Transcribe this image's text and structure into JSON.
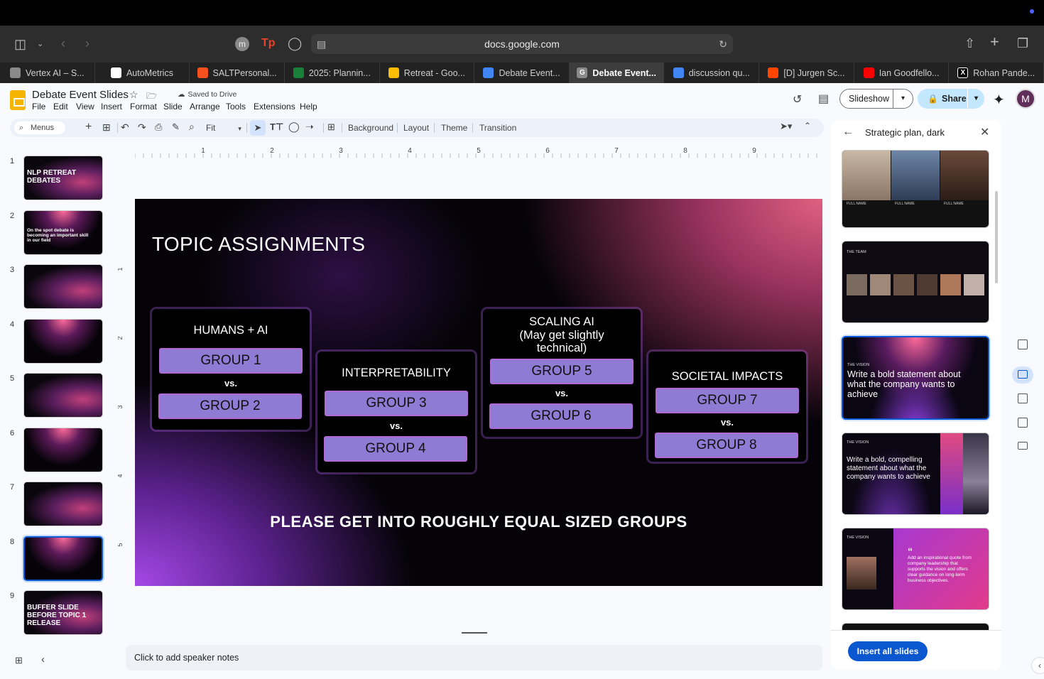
{
  "browser": {
    "url": "docs.google.com",
    "tabs": [
      {
        "label": "Vertex AI – S...",
        "icon": "google-cloud-icon",
        "color": "#8a8a8a"
      },
      {
        "label": "AutoMetrics",
        "icon": "automatrics-icon",
        "color": "#ffffff"
      },
      {
        "label": "SALTPersonal...",
        "icon": "flame-icon",
        "color": "#f4511e"
      },
      {
        "label": "2025: Plannin...",
        "icon": "sheets-icon",
        "color": "#188038"
      },
      {
        "label": "Retreat - Goo...",
        "icon": "drive-icon",
        "color": "#fbbc04"
      },
      {
        "label": "Debate Event...",
        "icon": "docs-icon",
        "color": "#4285f4"
      },
      {
        "label": "Debate Event...",
        "icon": "g-icon",
        "color": "#8a8a8a",
        "active": true
      },
      {
        "label": "discussion qu...",
        "icon": "docs-icon",
        "color": "#4285f4"
      },
      {
        "label": "[D] Jurgen Sc...",
        "icon": "reddit-icon",
        "color": "#ff4500"
      },
      {
        "label": "Ian Goodfello...",
        "icon": "youtube-icon",
        "color": "#ff0000"
      },
      {
        "label": "Rohan Pande...",
        "icon": "x-icon",
        "color": "#000000"
      }
    ]
  },
  "doc": {
    "title": "Debate Event Slides",
    "saved_status": "Saved to Drive",
    "menus": [
      "File",
      "Edit",
      "View",
      "Insert",
      "Format",
      "Slide",
      "Arrange",
      "Tools",
      "Extensions",
      "Help"
    ]
  },
  "toolbar": {
    "menus_label": "Menus",
    "zoom": "Fit",
    "background": "Background",
    "layout": "Layout",
    "theme": "Theme",
    "transition": "Transition"
  },
  "header_actions": {
    "slideshow": "Slideshow",
    "share": "Share",
    "avatar_letter": "M"
  },
  "filmstrip": [
    {
      "num": "1",
      "text": "NLP RETREAT DEBATES"
    },
    {
      "num": "2",
      "text": "On the spot debate is becoming an important skill in our field"
    },
    {
      "num": "3",
      "text": ""
    },
    {
      "num": "4",
      "text": ""
    },
    {
      "num": "5",
      "text": ""
    },
    {
      "num": "6",
      "text": ""
    },
    {
      "num": "7",
      "text": ""
    },
    {
      "num": "8",
      "text": "",
      "selected": true
    },
    {
      "num": "9",
      "text": "BUFFER SLIDE BEFORE TOPIC 1 RELEASE"
    }
  ],
  "ruler": {
    "h": [
      "1",
      "2",
      "3",
      "4",
      "5",
      "6",
      "7",
      "8",
      "9"
    ],
    "v": [
      "1",
      "2",
      "3",
      "4",
      "5"
    ]
  },
  "slide": {
    "title": "TOPIC ASSIGNMENTS",
    "topics": [
      {
        "heading": "HUMANS + AI",
        "group_a": "GROUP 1",
        "vs": "vs.",
        "group_b": "GROUP 2"
      },
      {
        "heading": "INTERPRETABILITY",
        "group_a": "GROUP 3",
        "vs": "vs.",
        "group_b": "GROUP 4"
      },
      {
        "heading": "SCALING AI\n(May get slightly technical)",
        "heading_l1": "SCALING AI",
        "heading_l2": "(May get slightly",
        "heading_l3": "technical)",
        "group_a": "GROUP 5",
        "vs": "vs.",
        "group_b": "GROUP 6"
      },
      {
        "heading": "SOCIETAL IMPACTS",
        "group_a": "GROUP 7",
        "vs": "vs.",
        "group_b": "GROUP 8"
      }
    ],
    "footer": "PLEASE GET INTO ROUGHLY EQUAL SIZED GROUPS"
  },
  "speaker_notes_placeholder": "Click to add speaker notes",
  "theme_panel": {
    "title": "Strategic plan, dark",
    "cards": [
      {
        "name": "team-photos",
        "label1": "FULL NAME",
        "label2": "FULL NAME",
        "label3": "FULL NAME"
      },
      {
        "name": "the-team",
        "heading": "THE TEAM"
      },
      {
        "name": "vision-1",
        "kicker": "THE VISION",
        "text": "Write a bold statement about what the company wants to achieve",
        "selected": true
      },
      {
        "name": "vision-2",
        "kicker": "THE VISION",
        "text": "Write a bold, compelling statement about what the company wants to achieve"
      },
      {
        "name": "vision-3",
        "kicker": "THE VISION",
        "text": "Add an inspirational quote from company leadership that supports the vision and offers clear guidance on long-term business objectives."
      }
    ],
    "insert_all": "Insert all slides"
  }
}
